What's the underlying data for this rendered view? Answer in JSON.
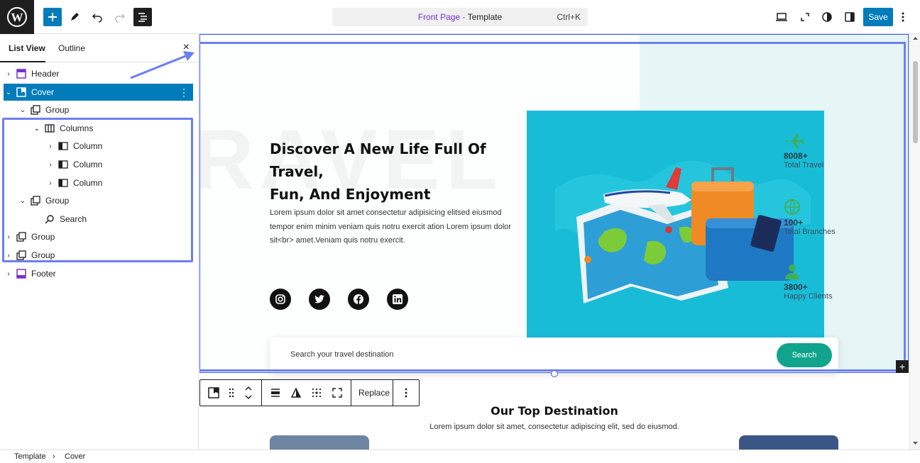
{
  "header": {
    "command": {
      "page": "Front Page",
      "separator": " · ",
      "kind": "Template",
      "shortcut": "Ctrl+K"
    },
    "save_label": "Save"
  },
  "sidebar": {
    "tabs": [
      "List View",
      "Outline"
    ],
    "close_symbol": "×",
    "tree": [
      {
        "label": "Header"
      },
      {
        "label": "Cover"
      },
      {
        "label": "Group"
      },
      {
        "label": "Columns"
      },
      {
        "label": "Column"
      },
      {
        "label": "Column"
      },
      {
        "label": "Column"
      },
      {
        "label": "Group"
      },
      {
        "label": "Search"
      },
      {
        "label": "Group"
      },
      {
        "label": "Group"
      },
      {
        "label": "Footer"
      }
    ]
  },
  "canvas": {
    "hero": {
      "title_line1": "Discover A New Life Full Of Travel,",
      "title_line2": "Fun, And Enjoyment",
      "text_line1": "Lorem ipsum dolor sit amet consectetur adipisicing elitsed eiusmod",
      "text_line2": "tempor enim minim veniam quis notru exercit ation Lorem ipsum dolor sit<br> amet.Veniam quis notru exercit."
    },
    "stats": [
      {
        "num": "8008+",
        "label": "Total Travel"
      },
      {
        "num": "100+",
        "label": "Total Branches"
      },
      {
        "num": "3800+",
        "label": "Happy Clients"
      }
    ],
    "search": {
      "placeholder": "Search your travel destination",
      "button": "Search"
    },
    "section": {
      "title": "Our Top Destination",
      "subtitle": "Lorem ipsum dolor sit amet, consectetur adipiscing elit, sed do eiusmod."
    }
  },
  "block_toolbar": {
    "replace_label": "Replace"
  },
  "breadcrumb": [
    "Template",
    "Cover"
  ],
  "colors": {
    "accent": "#007cba",
    "highlight": "#6b7ff1",
    "teal": "#11a48d",
    "image_bg": "#19bcd6"
  }
}
